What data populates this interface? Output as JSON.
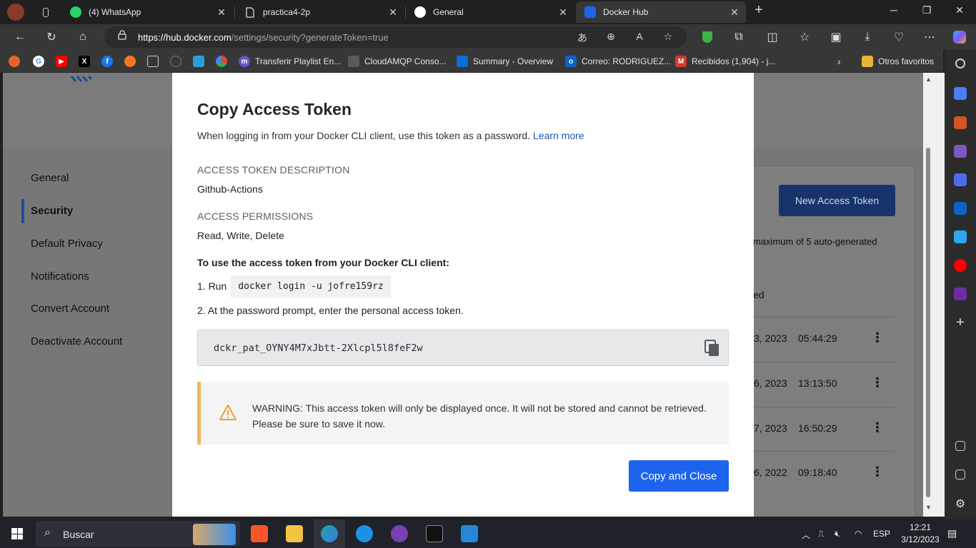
{
  "browser": {
    "tabs": [
      {
        "title": "(4) WhatsApp",
        "icon": "whatsapp-icon"
      },
      {
        "title": "practica4-2p",
        "icon": "document-icon"
      },
      {
        "title": "General",
        "icon": "github-icon"
      },
      {
        "title": "Docker Hub",
        "icon": "docker-icon",
        "active": true
      }
    ],
    "new_tab_label": "+",
    "url_host": "https://hub.docker.com",
    "url_path": "/settings/security?generateToken=true",
    "favorites": [
      {
        "label": "Transferir Playlist En...",
        "icon": "my-icon",
        "color": "#6e4fd0"
      },
      {
        "label": "CloudAMQP Conso...",
        "icon": "rabbit-icon",
        "color": "#5a5a5a"
      },
      {
        "label": "Summary - Overview",
        "icon": "azure-devops-icon",
        "color": "#0a6fd6"
      },
      {
        "label": "Correo: RODRIGUEZ...",
        "icon": "outlook-icon",
        "color": "#0a64c8"
      },
      {
        "label": "Recibidos (1,904) - j...",
        "icon": "gmail-icon",
        "color": "#d33b2c"
      }
    ],
    "other_favorites": "Otros favoritos"
  },
  "page": {
    "sidebar": [
      {
        "label": "General"
      },
      {
        "label": "Security",
        "active": true
      },
      {
        "label": "Default Privacy"
      },
      {
        "label": "Notifications"
      },
      {
        "label": "Convert Account"
      },
      {
        "label": "Deactivate Account"
      }
    ],
    "new_token_button": "New Access Token",
    "background_note": "maximum of 5 auto-generated",
    "background_col": "ed",
    "rows": [
      {
        "date": "3, 2023",
        "time": "05:44:29"
      },
      {
        "date": "6, 2023",
        "time": "13:13:50"
      },
      {
        "date": "7, 2023",
        "time": "16:50:29"
      },
      {
        "date": "6, 2022",
        "time": "09:18:40"
      }
    ]
  },
  "modal": {
    "title": "Copy Access Token",
    "description": "When logging in from your Docker CLI client, use this token as a password.",
    "learn_more": "Learn more",
    "desc_label": "ACCESS TOKEN DESCRIPTION",
    "desc_value": "Github-Actions",
    "perm_label": "ACCESS PERMISSIONS",
    "perm_value": "Read, Write, Delete",
    "instructions_heading": "To use the access token from your Docker CLI client:",
    "step1_prefix": "1. Run",
    "step1_command": "docker login -u jofre159rz",
    "step2": "2. At the password prompt, enter the personal access token.",
    "token": "dckr_pat_OYNY4M7xJbtt-2Xlcpl5l8feF2w",
    "warning": "WARNING: This access token will only be displayed once. It will not be stored and cannot be retrieved. Please be sure to save it now.",
    "copy_close_button": "Copy and Close"
  },
  "taskbar": {
    "search_placeholder": "Buscar",
    "language": "ESP",
    "time": "12:21",
    "date": "3/12/2023"
  },
  "colors": {
    "primary": "#1d63ed",
    "warning_accent": "#f0b85a",
    "link": "#1a57b7"
  }
}
